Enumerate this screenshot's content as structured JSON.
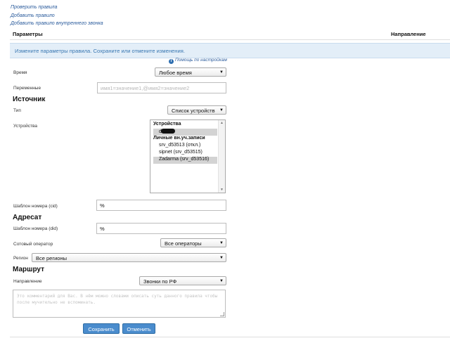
{
  "top_links": [
    "Проверить правила",
    "Добавить правило",
    "Добавить правило внутреннего звонка"
  ],
  "table_header": {
    "params": "Параметры",
    "direction": "Направление"
  },
  "alert_text": "Измените параметры правила. Сохраните или отмените изменения.",
  "help_link": "Помощь по настройкам",
  "time": {
    "label": "Время",
    "value": "Любое время"
  },
  "variables": {
    "label": "Переменные",
    "placeholder": "имя1=значение1,@имя2=значение2"
  },
  "source": {
    "heading": "Источник",
    "type_label": "Тип",
    "type_value": "Список устройств",
    "devices_label": "Устройства",
    "devices_list": {
      "group1": "Устройства",
      "item1": "di",
      "group2": "Личные вн.уч.записи",
      "item2": "srv_d53513 (откл.)",
      "item3": "sipnet (srv_d53515)",
      "item4": "Zadarma (srv_d53516)"
    },
    "cid_label": "Шаблон номера (cid)",
    "cid_value": "%"
  },
  "destination": {
    "heading": "Адресат",
    "did_label": "Шаблон номера (did)",
    "did_value": "%",
    "operator_label": "Сотовый оператор",
    "operator_value": "Все операторы",
    "region_label": "Регион",
    "region_value": "Все регионы"
  },
  "route": {
    "heading": "Маршрут",
    "direction_label": "Направление",
    "direction_value": "Звонки по РФ",
    "comment_placeholder": "Это комментарий для Вас. В нём можно словами описать суть данного правила чтобы после мучительно не вспоминать."
  },
  "buttons": {
    "save": "Сохранить",
    "cancel": "Отменить"
  }
}
